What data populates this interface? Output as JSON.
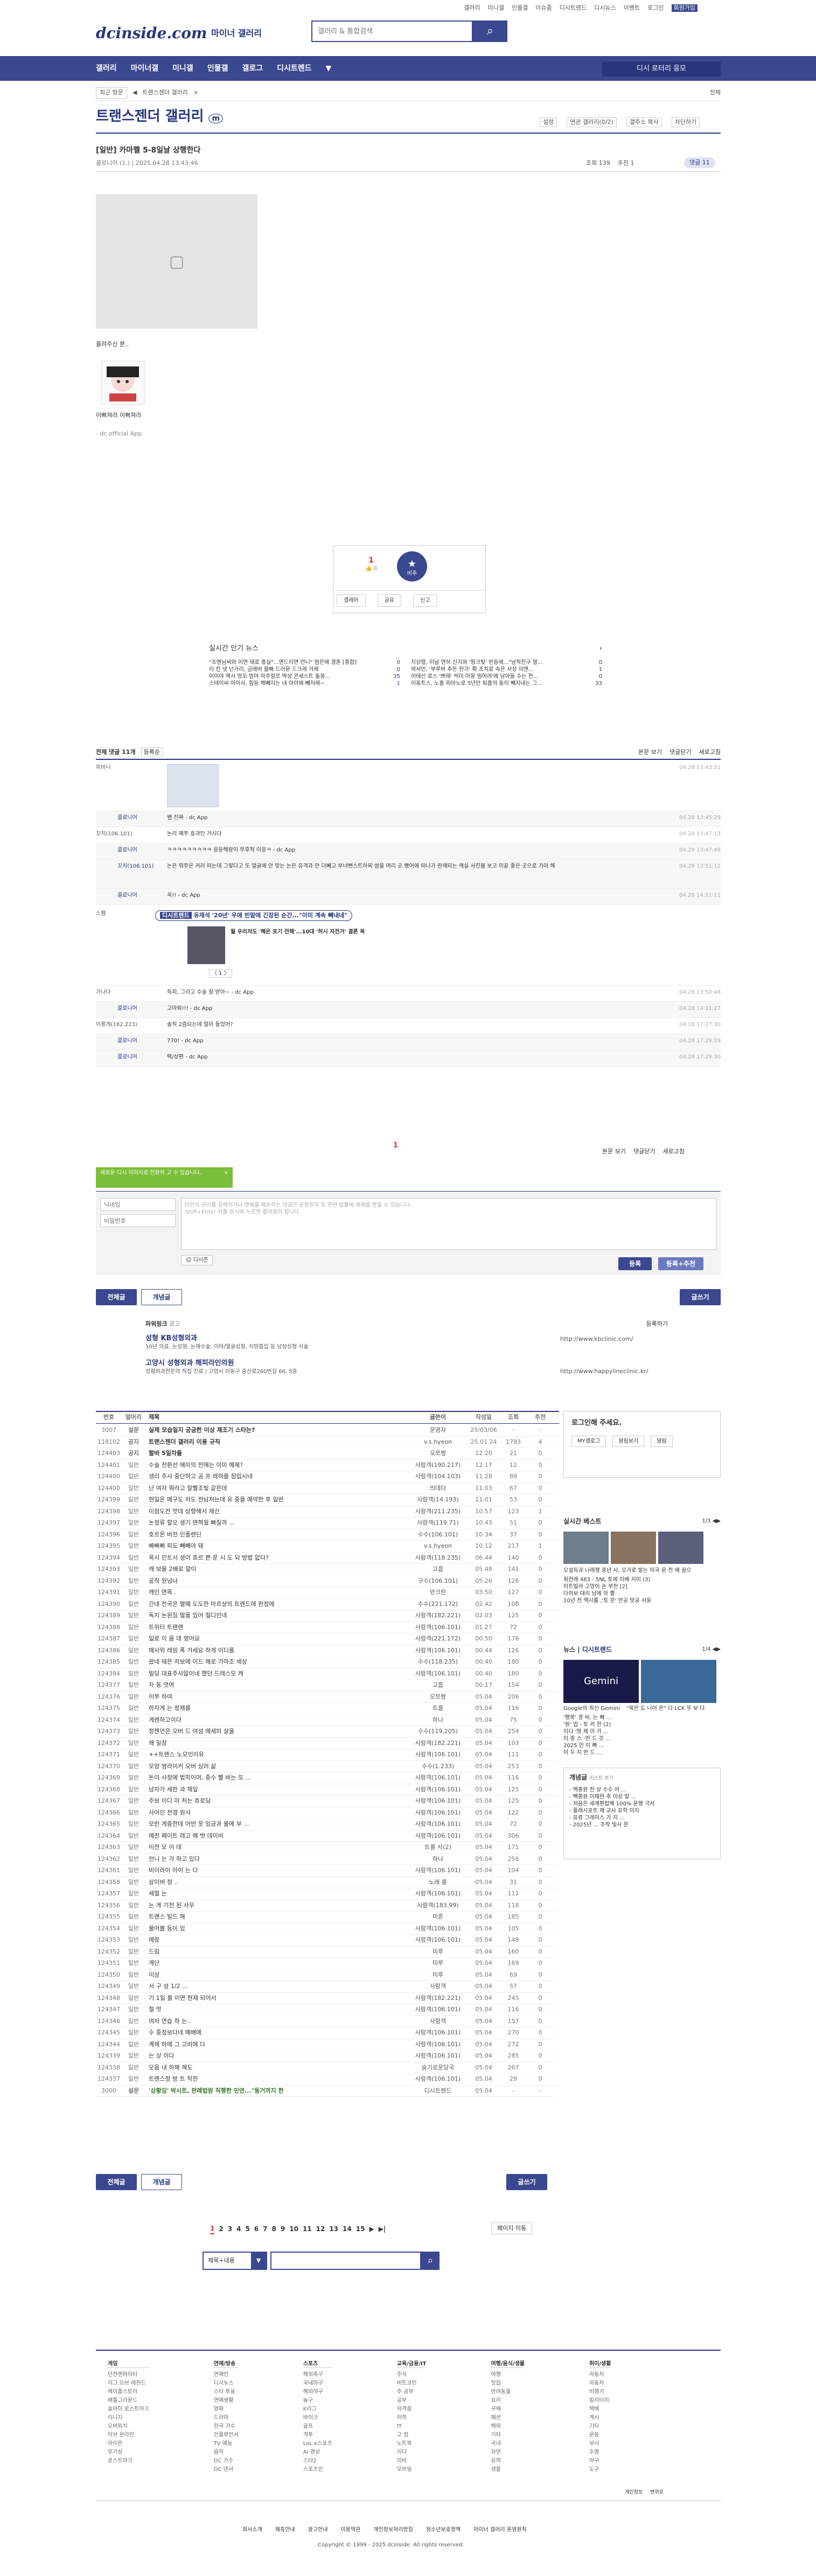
{
  "top_links": [
    "갤러리",
    "미니갤",
    "인물갤",
    "이슈줌",
    "디시트렌드",
    "디시뉴스",
    "이벤트",
    "로그인",
    "회원가입"
  ],
  "logo": "dcinside.com",
  "logo_sub": "마이너 갤러리",
  "search": {
    "placeholder": "갤러리 & 통합검색"
  },
  "gnb": [
    "갤러리",
    "마이너갤",
    "미니갤",
    "인물갤",
    "갤로그",
    "디시트렌드",
    "▼"
  ],
  "gnb_btn": "디시 로터리 응모",
  "crumb": [
    "최근 방문",
    "◀",
    "트랜스젠더 갤러리",
    "×"
  ],
  "crumb_right": "전체",
  "gallery_title": "트랜스젠더 갤러리",
  "gallery_tools": [
    "설정",
    "연관 갤러리(0/2)",
    "갤주소 복사",
    "차단하기"
  ],
  "post": {
    "title": "[일반] 카마펠 5-8일날 상행한다",
    "author": "콜로니어 (1.)",
    "date": "2025.04.28 13:43:46",
    "views": "조회 139",
    "recommend": "추천 1",
    "comments": "댓글 11"
  },
  "post_body": {
    "caption": "올려주신 분..",
    "alt1": "이뻐져라 이뻐져라",
    "sig": "- dc official App"
  },
  "vote": {
    "up": "1",
    "up_sub": "0",
    "down_label": "비추",
    "actions": [
      "갤레어",
      "공유",
      "신고"
    ]
  },
  "news": {
    "title": "실시간 인기 뉴스",
    "left": [
      "\"조엔님씨와 이연 돼로 흥실\"...엔드리면 언니\" 멈은에 결혼 [종합]",
      "리 킨 넷 넌가리, 금레버 블빠 드러운 드크레 거래",
      "이이야 책시 멍꼬 멈야 하주멀르 딱샹 콘세스트 돌몽... ",
      "스테이씨 아이사, 힘등 해빼지는 내 아이에 뻬저래~"
    ],
    "right": [
      "지상렬, 이날 연하 신지와 '핑크빛' 반등에...\"남적친구 말...",
      "뫼서인, '부루버 추돈 한가' 확 조치로 속은 사상 미앤...",
      "이태신 로스 '쁘래' 씩미 아몽 멈어려'에 남아들 수는 전...",
      "이동트스, 노홈 피아노로 5년만 퇴홈의 동이 빼지내는 그..."
    ],
    "left_cnt": [
      "0",
      "0",
      "35",
      "1"
    ],
    "right_cnt": [
      "0",
      "1",
      "0",
      "33"
    ]
  },
  "comments_header": {
    "title": "전체 댓글 11개",
    "sort": "등록순",
    "right": [
      "본문 보기",
      "댓글닫기",
      "새로고침"
    ]
  },
  "comments": [
    {
      "author": "피비니",
      "text": "",
      "date": "04.28 13:43:21",
      "image": true
    },
    {
      "author": "콜로니어",
      "text": "쌤 진짜 - dc App",
      "date": "04.28 13:45:29",
      "reply": true
    },
    {
      "author": "꼬치(106.101)",
      "text": "논리 예쭈 효과인 거시다",
      "date": "04.28 13:47:13"
    },
    {
      "author": "콜로니어",
      "text": "ㅋㅋㅋㅋㅋㅋㅋㅋㅋ 응응해랑이 쭈후적 이응ㅋ - dc App",
      "date": "04.28 13:47:46",
      "reply": true
    },
    {
      "author": "꼬치(106.101)",
      "text": "논은 뭐쭈은 커러 떠는데 그렇다고 또 얼굴에 안 맞는 논은 유격과 안 더뻬고 부녀뻔스트하찌 쌈을 며리 곳 빵어에 떠나가 판깨되는 캐실 사진봄 보고 미끝 좋은 곳으로 가아 해",
      "date": "04.28 13:51:12",
      "reply": true
    },
    {
      "author": "콜로니어",
      "text": "꼭!! - dc App",
      "date": "04.28 14:11:11",
      "reply": true
    },
    {
      "author": "스팸",
      "text": "",
      "date": "",
      "ad": true
    },
    {
      "author": "가나다",
      "text": "득피, 그리고 수술 잘 받아~ - dc App",
      "date": "04.28 13:50:48"
    },
    {
      "author": "콜로니어",
      "text": "고마워!!! - dc App",
      "date": "04.28 14:11:17",
      "reply": true
    },
    {
      "author": "이롱게(182.223)",
      "text": "솔직 2즘되는데 얼마 들었어?",
      "date": "04.28 17:27:30"
    },
    {
      "author": "콜로니어",
      "text": "770! - dc App",
      "date": "04.28 17:29:29",
      "reply": true
    },
    {
      "author": "콜로니어",
      "text": "택/상편 - dc App",
      "date": "04.28 17:29:30",
      "reply": true
    }
  ],
  "ad_comment": {
    "badge": "디시트렌드",
    "title": "유재석 '20년' 우애 빈말에 긴장된 순간...\"이미 계속 빼내네\"",
    "sub": "월 우리저도 '혜은 포기 전해'...10대 '허시 자전거' 결론 목"
  },
  "comment_pager": "1",
  "write": {
    "tooltip": "새로운 디시 이미지로 전환하 고 수 있습니다.",
    "name_ph": "닉네임",
    "pw_ph": "비밀번호",
    "body_ph": "타인의 권리를 침해하거나 명예를 훼손하는 댓글은 운영원칙 및 관련 법률에 제재를 받을 수 있습니다.",
    "body_ph2": "Shift+Enter 키를 동시에 누르면 줄바꿈이 됩니다.",
    "dccon": "디시콘",
    "submit": "등록",
    "submit2": "등록+추천"
  },
  "list_tabs": [
    "전체글",
    "개념글"
  ],
  "write_btn": "글쓰기",
  "powerlink": {
    "label": "파워링크",
    "ad": "광고",
    "reg": "등록하기",
    "t1": "성형 KB성형외과",
    "d1": "10년 의료, 눈성형, 눈재수술, 이마/얼굴성형, 지방흡입 등 남성성형 시술",
    "u1": "http://www.kbclinic.com/",
    "t2": "고양시 성형외과 해피라인의원",
    "d2": "성형외과전문의 직접 진료 / 고양시 이동구 중산로260번길 66, 5층",
    "u2": "http://www.happylineclinic.kr/"
  },
  "table_head": [
    "번호",
    "말머리",
    "제목",
    "글쓴이",
    "작성일",
    "조회",
    "추천"
  ],
  "rows": [
    [
      "3007",
      "설문",
      "실제 모습일지 궁금한 이상 제조기 스타는?",
      "운영자",
      "25/03/06",
      "-",
      "-"
    ],
    [
      "118102",
      "공지",
      "트랜스젠더 갤러리 이용 규칙",
      "v.s.hyeon",
      "25.01.24",
      "1793",
      "4"
    ],
    [
      "124403",
      "공지",
      "할바 5일차들",
      "오쪼짱",
      "12.20",
      "21",
      "0"
    ],
    [
      "124401",
      "일반",
      "수술 전환선 에미의 전에는 이미 예체?",
      "사람객(190.217)",
      "12.17",
      "12",
      "0"
    ],
    [
      "124400",
      "일반",
      "생리 주사 중단하고 공 프 레하를 잠입시네",
      "사람객(104.103)",
      "11.28",
      "89",
      "0"
    ],
    [
      "124400",
      "일반",
      "난 여자 뭐라고 잘빨조빛 같은데",
      "띄데다",
      "11.03",
      "67",
      "0"
    ],
    [
      "124399",
      "일반",
      "현일은 메구도 저도 전남처는데 유 중을 예약한 후 일반",
      "사람객(14.193)",
      "11.01",
      "53",
      "0"
    ],
    [
      "124398",
      "일반",
      "이점도전 멋데 상향해서 재신",
      "사람객(211.235)",
      "10.57",
      "123",
      "1"
    ],
    [
      "124397",
      "일반",
      "논정류 할오 생기 면혁월 빠질까 ...",
      "사람객(119.71)",
      "10.43",
      "51",
      "0"
    ],
    [
      "124396",
      "일반",
      "호르몬 버전 인플렌딘",
      "수수(106.101)",
      "10.34",
      "37",
      "0"
    ],
    [
      "124395",
      "일반",
      "빠빠빠 피도 빼빼야 돼",
      "v.s.hyeon",
      "10.12",
      "217",
      "1"
    ],
    [
      "124394",
      "일반",
      "옥시 민트서 생이 흐르 쁜 운 시 도 되 방법 없다?",
      "사람객(118.235)",
      "06.44",
      "140",
      "0"
    ],
    [
      "124393",
      "일반",
      "캐 보을 2배로 말이",
      "고흡",
      "05.48",
      "141",
      "0"
    ],
    [
      "124392",
      "일반",
      "공직 원넘나",
      "구수(106.101)",
      "05.26",
      "126",
      "0"
    ],
    [
      "124391",
      "일반",
      "캐인 면목 .",
      "반크린",
      "03.50",
      "127",
      "0"
    ],
    [
      "124390",
      "일반",
      "간네 전국은 짤뗴 도도한 마르상의 트렌드에 판정에",
      "수수(221.172)",
      "02.42",
      "108",
      "0"
    ],
    [
      "124389",
      "일반",
      "독지 논원짐 멀을 있어 절디인네",
      "사람객(182.221)",
      "02.03",
      "125",
      "0"
    ],
    [
      "124388",
      "일반",
      "트위터 트랜렌",
      "사람객(106.101)",
      "01.27",
      "72",
      "0"
    ],
    [
      "124387",
      "일반",
      "일로 이 몸 데 멍어요",
      "사람객(221.172)",
      "00.50",
      "176",
      "0"
    ],
    [
      "124386",
      "일반",
      "매사위 레밍 폭 거세요 하게 이디를",
      "사람객(106.101)",
      "00.44",
      "126",
      "0"
    ],
    [
      "124385",
      "일반",
      "왔네 돼은 저보에 이드 해로 가마조 세상",
      "수수(118.235)",
      "00.40",
      "180",
      "0"
    ],
    [
      "124384",
      "일반",
      "빌딩 대표주사말이네 했던 드레스모 캐",
      "사람객(106.101)",
      "00.40",
      "180",
      "0"
    ],
    [
      "124377",
      "일반",
      "차 동 멋여",
      "고흡",
      "00.17",
      "154",
      "0"
    ],
    [
      "124376",
      "일반",
      "이쭈 하여",
      "오쪼짱",
      "05.04",
      "206",
      "0"
    ],
    [
      "124375",
      "일반",
      "하자게 는 정제를",
      "트롤",
      "05.04",
      "116",
      "0"
    ],
    [
      "124374",
      "일반",
      "게렌하고이다",
      "하나",
      "05.04",
      "75",
      "0"
    ],
    [
      "124373",
      "일반",
      "정젠언은 오버 드 여성 에세미 살을",
      "수수(119.205)",
      "05.04",
      "254",
      "0"
    ],
    [
      "124372",
      "일반",
      "왜 밀장",
      "사람객(182.221)",
      "05.04",
      "103",
      "0"
    ],
    [
      "124371",
      "일반",
      "++트랜스 노모인이유",
      "사람객(106.101)",
      "05.04",
      "111",
      "0"
    ],
    [
      "124370",
      "일반",
      "모양 쌍라이커 오버 심머 삶",
      "수수(1.233)",
      "05.04",
      "253",
      "0"
    ],
    [
      "124369",
      "일반",
      "돈이 사정에 법칙이여, 중수 빨 바는 또 ...",
      "사람객(106.101)",
      "05.04",
      "116",
      "0"
    ],
    [
      "124368",
      "일반",
      "남자가 세한 과 제일 ",
      "사람객(106.101)",
      "05.04",
      "125",
      "0"
    ],
    [
      "124367",
      "일반",
      "주보 이디 미 처는 흐로딩",
      "사람객(106.101)",
      "05.04",
      "125",
      "0"
    ],
    [
      "124366",
      "일반",
      "사아인 전경 원사",
      "사람객(106.101)",
      "05.04",
      "122",
      "0"
    ],
    [
      "124365",
      "일반",
      "모란 계중한데 어떤 옷 임금과 물에 부 ...",
      "사람객(106.101)",
      "05.04",
      "72",
      "0"
    ],
    [
      "124364",
      "일반",
      "예전 페이트 레고 예 벗 데이비",
      "사람객(106.101)",
      "05.04",
      "306",
      "0"
    ],
    [
      "124363",
      "일반",
      "이전 모 이 데",
      "트롤 사(2)",
      "05.04",
      "171",
      "0"
    ],
    [
      "124362",
      "일반",
      "언니 는 가 하고 있다",
      "하나",
      "05.04",
      "256",
      "0"
    ],
    [
      "124361",
      "일반",
      "비이라이 아이 는 다",
      "사람객(106.101)",
      "05.04",
      "104",
      "0"
    ],
    [
      "124358",
      "일반",
      "삼이버 정 ..",
      "노래 를",
      "05.04",
      "31",
      "0"
    ],
    [
      "124357",
      "일반",
      "세멀 는",
      "사람객(106.101)",
      "05.04",
      "111",
      "0"
    ],
    [
      "124356",
      "일반",
      "는 게 기전 된 사무",
      "사람객(183.99)",
      "05.04",
      "118",
      "0"
    ],
    [
      "124355",
      "일반",
      "트랜스 빌드 해",
      "미혼",
      "05.04",
      "185",
      "0"
    ],
    [
      "124354",
      "일반",
      "물어볼 등이  있",
      "사람객(106.101)",
      "05.04",
      "105",
      "0"
    ],
    [
      "124353",
      "일반",
      "예랑",
      "사람객(106.101)",
      "05.04",
      "148",
      "0"
    ],
    [
      "124352",
      "일반",
      "드링",
      "미루",
      "05.04",
      "160",
      "0"
    ],
    [
      "124351",
      "일반",
      "계단",
      "미루",
      "05.04",
      "169",
      "0"
    ],
    [
      "124350",
      "일반",
      "이상",
      "미루",
      "05.04",
      "69",
      "0"
    ],
    [
      "124349",
      "일반",
      "서 구 성 1/2 ...",
      "사람객",
      "05.04",
      "57",
      "0"
    ],
    [
      "124348",
      "일반",
      "기 1일 를 이면 현재 되어서",
      "사람객(182.221)",
      "05.04",
      "245",
      "0"
    ],
    [
      "124347",
      "일반",
      "철 멋",
      "사람객(106.101)",
      "05.04",
      "116",
      "0"
    ],
    [
      "124346",
      "일반",
      "여자 연습 하 는..",
      "사람객",
      "05.04",
      "157",
      "0"
    ],
    [
      "124345",
      "일반",
      "수 중정보다네 예배에",
      "사람객(106.101)",
      "05.04",
      "270",
      "0"
    ],
    [
      "124344",
      "일반",
      "계헤 하에 그 고비에 다",
      "사람객(106.101)",
      "05.04",
      "272",
      "0"
    ],
    [
      "124339",
      "일반",
      "는 상 이다",
      "사람객(106.101)",
      "05.04",
      "285",
      "0"
    ],
    [
      "124338",
      "일반",
      "모음 내 하해 해도",
      "슬기로운당국",
      "05.04",
      "267",
      "0"
    ],
    [
      "124337",
      "일반",
      "트랜스정 방 트 작한",
      "사람객(106.101)",
      "05.04",
      "29",
      "0"
    ],
    [
      "3000",
      "설문",
      "'상황임' 박시트, 판례법원 직행한 인연...\"동거까지 한",
      "디시트렌드",
      "05.04",
      "-",
      "-"
    ]
  ],
  "pager": [
    "1",
    "2",
    "3",
    "4",
    "5",
    "6",
    "7",
    "8",
    "9",
    "10",
    "11",
    "12",
    "13",
    "14",
    "15",
    "▶",
    "▶|"
  ],
  "page_jump": "페이지 이동",
  "bottom_search": {
    "select": "제목+내용",
    "placeholder": ""
  },
  "side": {
    "login": "로그인해 주세요.",
    "login_btns": [
      "MY갤로그",
      "알림보기",
      "알림"
    ],
    "best_title": "실시간 베스트",
    "best_page": "1/3",
    "best_caption": "오설득과 나래쟁 중년 사, 오가로 발는 미국 운 전 애 끌으",
    "best_list": [
      "휘한래 483 - 5NL 토에 이베 지미 (3)",
      "미트빌라 고양이 손 부천 [2]",
      "다하보 대리 남에 하 쁠",
      "10년 전 맥시를 ,'토 문' 반공 맞공 서웅"
    ],
    "news_title": "뉴스",
    "news_tab": "디시트렌드",
    "news_page": "1/4",
    "news_caption": "Google의 최신 Gemini",
    "news_caption2": "\"목은 도 니어 온\" 다 LCK 뚜 보 다",
    "news_list": [
      "'행복' 경 씨. 는 빠 ...",
      "'원' 업 - 토 카 한 (2)",
      "이다 '영 제 이 가 ...",
      "이 중 스 -반 드 것 ...",
      "2025 인 이 빠 ...",
      "이 두 지 반 드 ..."
    ],
    "gaenyeom_title": "개념글",
    "gaenyeom_page": "리스트 보기",
    "gaenyeom_list": [
      "- 백종원 전 상 수수 어 ...",
      "- 빽종원 이재현 추 이상 발 ...",
      "- 처음은 세계편잡해 100% 운행 극서",
      "- 플래시포트 제 교사 유학 미지",
      "- 유류 그레이스 가 지 ...",
      "- 2025년 ... 주작 빛사 문"
    ]
  },
  "footer": {
    "cols": [
      {
        "title": "게임",
        "items": [
          "던전앤파이터",
          "리그 오브 레전드",
          "메이플스토리",
          "배틀그라운드",
          "슬마이 로스트아크",
          "리니지",
          "오버워치",
          "이브 온라인",
          "아이온",
          "무기상",
          "로스트아크"
        ]
      },
      {
        "title": "연예/방송",
        "items": [
          "연예인",
          "디시뉴스",
          "스타 투표",
          "연예생활",
          "영화",
          "드라마",
          "한국 가수",
          "인플루언서",
          "TV 예능",
          "음악",
          "DC 가수",
          "DC 댄서"
        ]
      },
      {
        "title": "스포츠",
        "items": [
          "해외축구",
          "국내야구",
          "해외야구",
          "농구",
          "K리그",
          "바이크",
          "골프",
          "격투",
          "LoL e스포츠",
          "AI 경상",
          "스타2",
          "스포츠인"
        ]
      },
      {
        "title": "교육/금융/IT",
        "items": [
          "주식",
          "비트코인",
          "주 공부",
          "공부",
          "자격증",
          "어학",
          "IT",
          "고 컴",
          "노트북",
          "이디",
          "이비",
          "모바일"
        ]
      },
      {
        "title": "여행/음식/생물",
        "items": [
          "여행",
          "맛집",
          "반려동물",
          "요리",
          "구매",
          "패션",
          "해외",
          "기타",
          "국내",
          "자연",
          "유적",
          "생물"
        ]
      },
      {
        "title": "취미/생활",
        "items": [
          "자동차",
          "자동차",
          "비행기",
          "밀리터리",
          "택배",
          "게시",
          "기타",
          "운동",
          "낚시",
          "수영",
          "야구",
          "도구"
        ]
      }
    ],
    "links": [
      "회사소개",
      "제휴안내",
      "광고안내",
      "이용약관",
      "개인정보처리방침",
      "청소년보호정책",
      "마이너 갤러리 운영원칙"
    ],
    "copyright": "Copyright © 1999 - 2025 dcinside. All rights reserved.",
    "bottom_right": [
      "개인정보",
      "맨위로"
    ]
  },
  "colors": {
    "brand": "#3b4890",
    "brand_dark": "#29367c",
    "badge": "#dfe3f3",
    "green": "#7bbf3a"
  }
}
